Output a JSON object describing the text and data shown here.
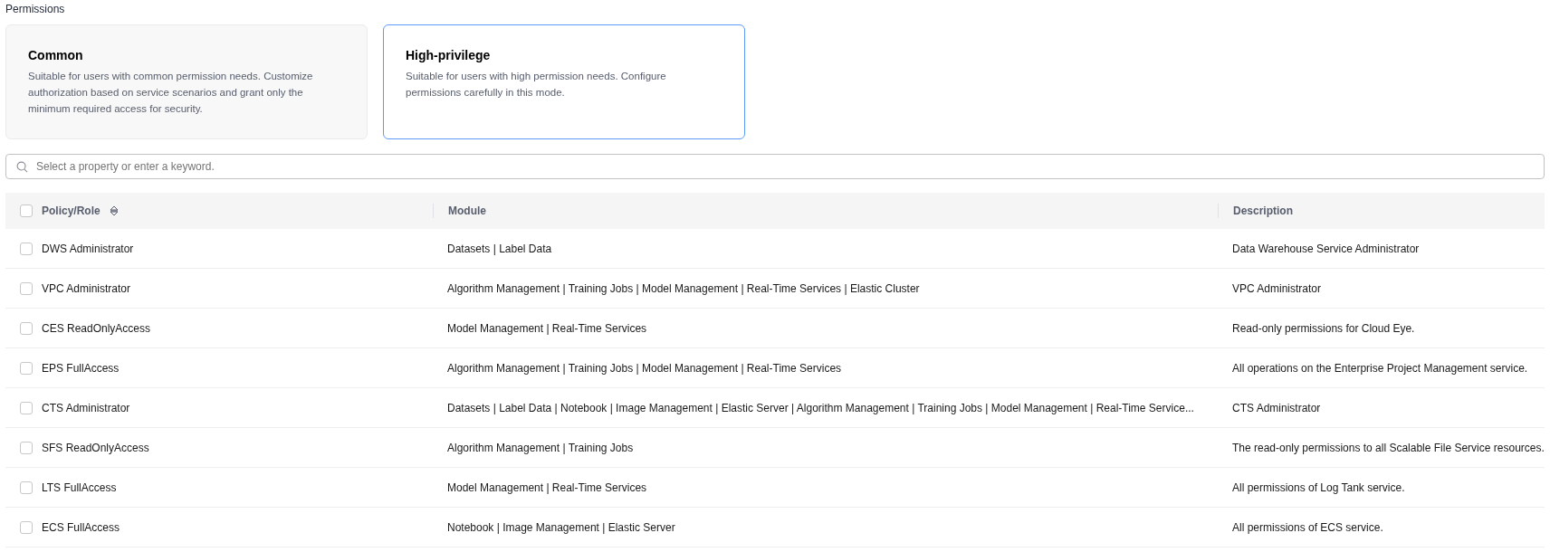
{
  "section_title": "Permissions",
  "modes": [
    {
      "title": "Common",
      "description": "Suitable for users with common permission needs. Customize authorization based on service scenarios and grant only the minimum required access for security.",
      "selected": false
    },
    {
      "title": "High-privilege",
      "description": "Suitable for users with high permission needs. Configure permissions carefully in this mode.",
      "selected": true
    }
  ],
  "search": {
    "placeholder": "Select a property or enter a keyword."
  },
  "table": {
    "select_all_checked": false,
    "columns": [
      "Policy/Role",
      "Module",
      "Description"
    ],
    "rows": [
      {
        "checked": false,
        "policy": "DWS Administrator",
        "module": "Datasets | Label Data",
        "description": "Data Warehouse Service Administrator"
      },
      {
        "checked": false,
        "policy": "VPC Administrator",
        "module": "Algorithm Management | Training Jobs | Model Management | Real-Time Services | Elastic Cluster",
        "description": "VPC Administrator"
      },
      {
        "checked": false,
        "policy": "CES ReadOnlyAccess",
        "module": "Model Management | Real-Time Services",
        "description": "Read-only permissions for Cloud Eye."
      },
      {
        "checked": false,
        "policy": "EPS FullAccess",
        "module": "Algorithm Management | Training Jobs | Model Management | Real-Time Services",
        "description": "All operations on the Enterprise Project Management service."
      },
      {
        "checked": false,
        "policy": "CTS Administrator",
        "module": "Datasets | Label Data | Notebook | Image Management | Elastic Server | Algorithm Management | Training Jobs | Model Management | Real-Time Service...",
        "description": "CTS Administrator"
      },
      {
        "checked": false,
        "policy": "SFS ReadOnlyAccess",
        "module": "Algorithm Management | Training Jobs",
        "description": "The read-only permissions to all Scalable File Service resources."
      },
      {
        "checked": false,
        "policy": "LTS FullAccess",
        "module": "Model Management | Real-Time Services",
        "description": "All permissions of Log Tank service."
      },
      {
        "checked": false,
        "policy": "ECS FullAccess",
        "module": "Notebook | Image Management | Elastic Server",
        "description": "All permissions of ECS service."
      }
    ]
  }
}
